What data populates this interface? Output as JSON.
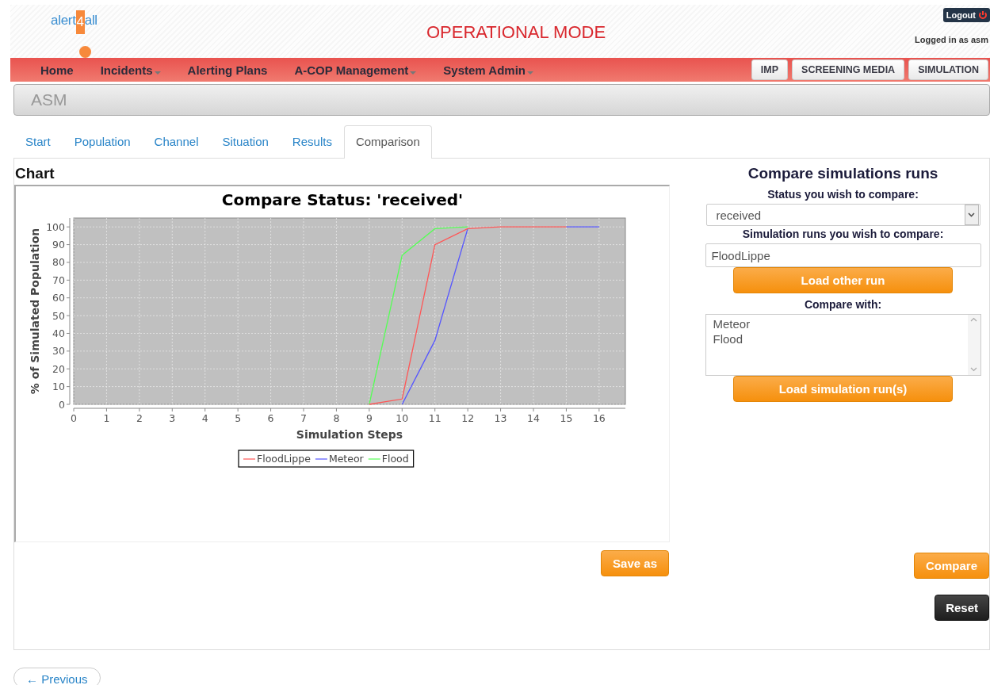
{
  "header": {
    "logo": {
      "before": "alert",
      "mark": "4",
      "after": "all"
    },
    "mode": "OPERATIONAL MODE",
    "logout": "Logout",
    "user": "Logged in as asm"
  },
  "nav": {
    "items": [
      {
        "label": "Home",
        "has_menu": false
      },
      {
        "label": "Incidents",
        "has_menu": true
      },
      {
        "label": "Alerting Plans",
        "has_menu": false
      },
      {
        "label": "A-COP Management",
        "has_menu": true
      },
      {
        "label": "System Admin",
        "has_menu": true
      }
    ],
    "modules": [
      "IMP",
      "SCREENING MEDIA",
      "SIMULATION"
    ]
  },
  "section": "ASM",
  "tabs": [
    {
      "label": "Start",
      "selected": false
    },
    {
      "label": "Population",
      "selected": false
    },
    {
      "label": "Channel",
      "selected": false
    },
    {
      "label": "Situation",
      "selected": false
    },
    {
      "label": "Results",
      "selected": false
    },
    {
      "label": "Comparison",
      "selected": true
    }
  ],
  "chart_panel": {
    "heading": "Chart",
    "chart_data": {
      "type": "line",
      "title": "Compare Status: 'received'",
      "xlabel": "Simulation Steps",
      "ylabel": "% of Simulated Population",
      "x": [
        9,
        10,
        11,
        12,
        13,
        14,
        15,
        16
      ],
      "series": [
        {
          "name": "FloodLippe",
          "color": "#ff5555",
          "values": [
            0,
            3,
            90,
            99,
            100,
            100,
            100,
            null
          ]
        },
        {
          "name": "Meteor",
          "color": "#5555ff",
          "values": [
            null,
            0,
            36,
            99,
            null,
            null,
            100,
            100
          ]
        },
        {
          "name": "Flood",
          "color": "#55ff55",
          "values": [
            0,
            84,
            99,
            100,
            null,
            null,
            null,
            null
          ]
        }
      ],
      "grid": true,
      "legend": true,
      "xlim": [
        0,
        16.8
      ],
      "ylim": [
        0,
        105
      ],
      "xticks": [
        0,
        1,
        2,
        3,
        4,
        5,
        6,
        7,
        8,
        9,
        10,
        11,
        12,
        13,
        14,
        15,
        16
      ],
      "yticks": [
        0,
        10,
        20,
        30,
        40,
        50,
        60,
        70,
        80,
        90,
        100
      ]
    },
    "save_button": "Save as"
  },
  "compare_panel": {
    "title": "Compare simulations runs",
    "status_label": "Status you wish to compare:",
    "status_value": "received",
    "runs_label": "Simulation runs you wish to compare:",
    "run_value": "FloodLippe",
    "load_other_button": "Load other run",
    "compare_with_label": "Compare with:",
    "compare_with_items": [
      "Meteor",
      "Flood"
    ],
    "load_runs_button": "Load simulation run(s)",
    "compare_button": "Compare",
    "reset_button": "Reset"
  },
  "previous_button": "← Previous"
}
